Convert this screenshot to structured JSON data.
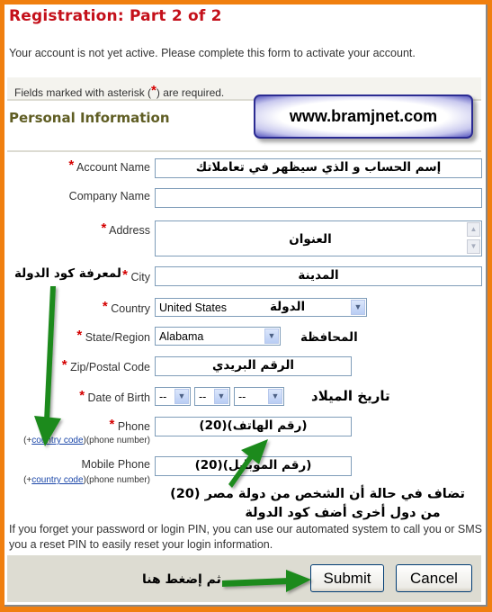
{
  "page": {
    "title": "Registration: Part 2 of 2",
    "intro": "Your account is not yet active. Please complete this form to activate your account.",
    "required_note_before": "Fields marked with asterisk (",
    "required_note_star": "*",
    "required_note_after": ") are required.",
    "section_title": "Personal Information",
    "brand_watermark": "www.bramjnet.com"
  },
  "form": {
    "account_name": {
      "label": "Account Name",
      "required": true,
      "value": "",
      "annotation": "إسم الحساب و الذي سيظهر في تعاملاتك"
    },
    "company_name": {
      "label": "Company Name",
      "required": false,
      "value": ""
    },
    "address": {
      "label": "Address",
      "required": true,
      "value": "",
      "annotation": "العنوان"
    },
    "city": {
      "label": "City",
      "required": true,
      "value": "",
      "annotation": "المدينة"
    },
    "country": {
      "label": "Country",
      "required": true,
      "selected": "United States",
      "annotation": "الدولة"
    },
    "state": {
      "label": "State/Region",
      "required": true,
      "selected": "Alabama",
      "annotation": "المحافظة"
    },
    "zip": {
      "label": "Zip/Postal Code",
      "required": true,
      "value": "",
      "annotation": "الرقم البريدي"
    },
    "dob": {
      "label": "Date of Birth",
      "required": true,
      "day": "--",
      "month": "--",
      "year": "--",
      "annotation": "تاريخ الميلاد"
    },
    "phone": {
      "label": "Phone",
      "required": true,
      "value": "",
      "annotation": "(رقم الهاتف)(20)",
      "hint_prefix": "(+",
      "hint_link": "country code",
      "hint_suffix": ")(phone number)"
    },
    "mobile": {
      "label": "Mobile Phone",
      "required": false,
      "value": "",
      "annotation": "(رقم الموبايل)(20)",
      "hint_prefix": "(+",
      "hint_link": "country code",
      "hint_suffix": ")(phone number)"
    }
  },
  "annotations": {
    "country_code_hint": "لمعرفة كود الدولة",
    "egypt_note_line1": "تضاف في حالة أن الشخص من دولة مصر (20)",
    "egypt_note_line2": "من دول أخرى أضف كود الدولة",
    "click_here": "ثم إضغط هنا"
  },
  "footer": {
    "text": "If you forget your password or login PIN, you can use our automated system to call you or SMS you a reset PIN to easily reset your login information."
  },
  "buttons": {
    "submit": "Submit",
    "cancel": "Cancel"
  },
  "colors": {
    "frame": "#f07f0f",
    "title": "#c4101a",
    "section_title": "#5f5d23",
    "required_star": "#d40000",
    "arrow": "#1e8a1e",
    "link": "#1a46a8"
  }
}
